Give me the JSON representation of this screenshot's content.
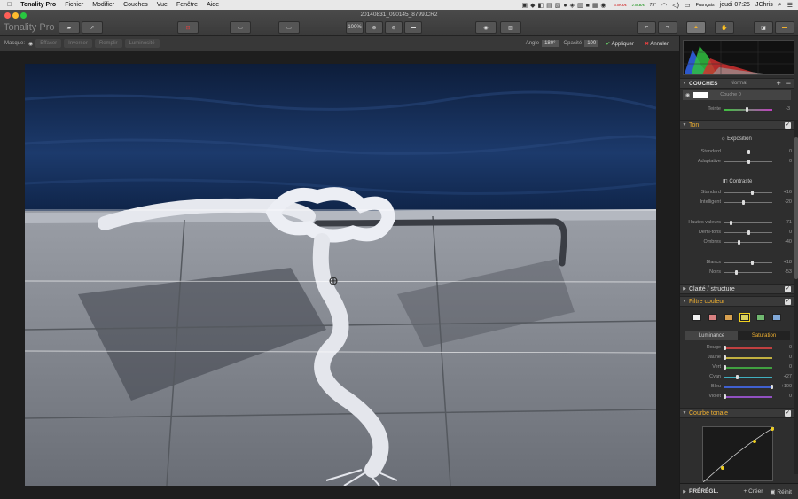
{
  "menubar": {
    "app_name": "Tonality Pro",
    "items": [
      "Fichier",
      "Modifier",
      "Couches",
      "Vue",
      "Fenêtre",
      "Aide"
    ],
    "language": "Français",
    "clock": "jeudi 07:25",
    "user": "JChris",
    "temp": "79°",
    "net_up": "3.0KB/s",
    "net_down": "2.0KB/s"
  },
  "window": {
    "filename": "20140831_090145_8799.CR2",
    "logo": "Tonality Pro",
    "zoom": "100%"
  },
  "maskbar": {
    "label": "Masque:",
    "buttons": [
      "Effacer",
      "Inverser",
      "Remplir",
      "Luminosité"
    ],
    "angle_label": "Angle",
    "angle_value": "180°",
    "opacity_label": "Opacité",
    "opacity_value": "100",
    "apply_label": "Appliquer",
    "cancel_label": "Annuler"
  },
  "panel": {
    "couches": {
      "title": "COUCHES",
      "mode": "Normal",
      "layer_name": "Couche 0"
    },
    "teinte": {
      "label": "Teinte",
      "value": "-3"
    },
    "ton": {
      "title": "Ton",
      "exposition_title": "Exposition",
      "exposition": [
        {
          "label": "Standard",
          "value": "0",
          "pos": 0.5
        },
        {
          "label": "Adaptative",
          "value": "0",
          "pos": 0.5
        }
      ],
      "contraste_title": "Contraste",
      "contraste": [
        {
          "label": "Standard",
          "value": "+16",
          "pos": 0.58
        },
        {
          "label": "Intelligent",
          "value": "-20",
          "pos": 0.4
        }
      ],
      "zones": [
        {
          "label": "Hautes valeurs",
          "value": "-71",
          "pos": 0.14
        },
        {
          "label": "Demi-tons",
          "value": "0",
          "pos": 0.5
        },
        {
          "label": "Ombres",
          "value": "-40",
          "pos": 0.3
        }
      ],
      "blancs": [
        {
          "label": "Blancs",
          "value": "+18",
          "pos": 0.59
        },
        {
          "label": "Noirs",
          "value": "-53",
          "pos": 0.24
        }
      ]
    },
    "clarte": {
      "title": "Clarté / structure"
    },
    "filtre": {
      "title": "Filtre couleur",
      "swatches": [
        "#f2f2f2",
        "#d88080",
        "#d8a050",
        "#d8d060",
        "#70b870",
        "#80a8d8"
      ],
      "tab_luminance": "Luminance",
      "tab_saturation": "Saturation",
      "channels": [
        {
          "label": "Rouge",
          "value": "0",
          "pos": 0.0,
          "color": "#c04040"
        },
        {
          "label": "Jaune",
          "value": "0",
          "pos": 0.0,
          "color": "#c0b040"
        },
        {
          "label": "Vert",
          "value": "0",
          "pos": 0.0,
          "color": "#40a040"
        },
        {
          "label": "Cyan",
          "value": "+27",
          "pos": 0.27,
          "color": "#40b0c0"
        },
        {
          "label": "Bleu",
          "value": "+100",
          "pos": 1.0,
          "color": "#4060d0"
        },
        {
          "label": "Violet",
          "value": "0",
          "pos": 0.0,
          "color": "#9050c0"
        }
      ]
    },
    "courbe": {
      "title": "Courbe tonale"
    },
    "preregl": {
      "title": "PRÉRÉGL.",
      "create_label": "Créer",
      "reset_label": "Réinit"
    }
  },
  "colors": {
    "accent": "#f0b030",
    "apply_green": "#6c6",
    "cancel_red": "#e04040"
  }
}
